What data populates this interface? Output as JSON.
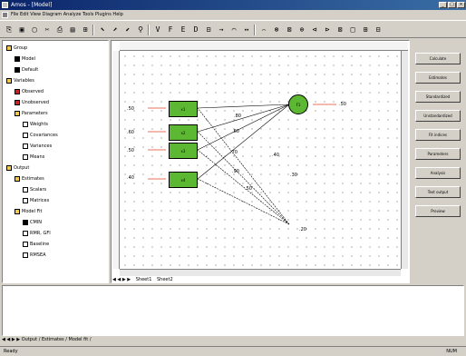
{
  "window": {
    "title": "Amos - [Model]",
    "min": "_",
    "max": "□",
    "close": "×"
  },
  "menubar": {
    "text": "File Edit View Diagram Analyze Tools Plugins Help"
  },
  "toolbar": {
    "buttons": [
      "⎘",
      "▣",
      "▢",
      "✂",
      "⎙",
      "▤",
      "⊞",
      "⬉",
      "⬈",
      "⬋",
      "⚲",
      "V",
      "F",
      "E",
      "D",
      "⊟",
      "→",
      "⌒",
      "↔",
      "⌢",
      "⊛",
      "⊠",
      "⊕",
      "⊲",
      "⊳",
      "⊠",
      "□",
      "⊞",
      "⊟"
    ]
  },
  "tree": {
    "items": [
      {
        "label": "Group",
        "indent": 0,
        "color": "#f2c94c"
      },
      {
        "label": "Model",
        "indent": 1,
        "color": "#000000"
      },
      {
        "label": "Default",
        "indent": 1,
        "color": "#000000"
      },
      {
        "label": "Variables",
        "indent": 0,
        "color": "#f2c94c"
      },
      {
        "label": "Observed",
        "indent": 1,
        "color": "#cc2222"
      },
      {
        "label": "Unobserved",
        "indent": 1,
        "color": "#cc2222"
      },
      {
        "label": "Parameters",
        "indent": 1,
        "color": "#f2c94c"
      },
      {
        "label": "Weights",
        "indent": 2,
        "color": "#ffffff"
      },
      {
        "label": "Covariances",
        "indent": 2,
        "color": "#ffffff"
      },
      {
        "label": "Variances",
        "indent": 2,
        "color": "#ffffff"
      },
      {
        "label": "Means",
        "indent": 2,
        "color": "#ffffff"
      },
      {
        "label": "Output",
        "indent": 0,
        "color": "#f2c94c"
      },
      {
        "label": "Estimates",
        "indent": 1,
        "color": "#f2c94c"
      },
      {
        "label": "Scalars",
        "indent": 2,
        "color": "#ffffff"
      },
      {
        "label": "Matrices",
        "indent": 2,
        "color": "#ffffff"
      },
      {
        "label": "Model Fit",
        "indent": 1,
        "color": "#f2c94c"
      },
      {
        "label": "CMIN",
        "indent": 2,
        "color": "#000000"
      },
      {
        "label": "RMR, GFI",
        "indent": 2,
        "color": "#ffffff"
      },
      {
        "label": "Baseline",
        "indent": 2,
        "color": "#ffffff"
      },
      {
        "label": "RMSEA",
        "indent": 2,
        "color": "#ffffff"
      }
    ]
  },
  "diagram": {
    "boxes": [
      "x1",
      "x2",
      "x3",
      "x4"
    ],
    "box_labels": [
      ".50",
      ".60",
      ".50",
      ".40"
    ],
    "latent": "F1",
    "latent_error": ".50",
    "path_labels": [
      ".80",
      ".60",
      ".70",
      ".90",
      ".50",
      ".40",
      ".30",
      ".20"
    ]
  },
  "sheettabs": {
    "nav": "◀ ◀ ▶ ▶",
    "tab1": "Sheet1",
    "tab2": "Sheet2"
  },
  "rightpanel": {
    "buttons": [
      "Calculate",
      "Estimates",
      "Standardized",
      "Unstandardized",
      "Fit indices",
      "Parameters",
      "Analysis",
      "Text output",
      "Preview"
    ]
  },
  "output": {
    "tabs": "◀ ◀ ▶ ▶ Output / Estimates / Model fit /"
  },
  "statusbar": {
    "left": "Ready",
    "right": "NUM"
  }
}
